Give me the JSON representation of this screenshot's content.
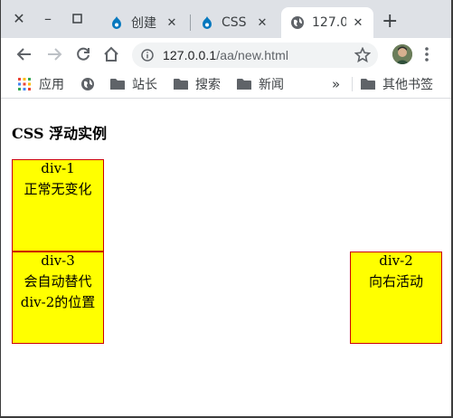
{
  "window_controls": {
    "close": "✕",
    "minimize": "–",
    "maximize": "□"
  },
  "tabs": [
    {
      "title": "创建",
      "icon": "drupal-icon",
      "close": "✕"
    },
    {
      "title": "CSS",
      "icon": "drupal-icon",
      "close": "✕"
    },
    {
      "title": "127.0",
      "icon": "globe-icon",
      "close": "✕",
      "active": true
    }
  ],
  "new_tab": "+",
  "toolbar": {
    "url_host": "127.0.0.1",
    "url_path": "/aa/new.html"
  },
  "bookmarks": {
    "items": [
      {
        "label": "应用",
        "icon": "apps-grid-icon"
      },
      {
        "label": "",
        "icon": "globe-icon"
      },
      {
        "label": "站长",
        "icon": "folder-icon"
      },
      {
        "label": "搜索",
        "icon": "folder-icon"
      },
      {
        "label": "新闻",
        "icon": "folder-icon"
      }
    ],
    "overflow": "»",
    "other": {
      "label": "其他书签",
      "icon": "folder-icon"
    }
  },
  "page": {
    "heading": "CSS 浮动实例",
    "boxes": [
      {
        "name": "div-1",
        "text": "正常无变化"
      },
      {
        "name": "div-2",
        "text": "向右活动"
      },
      {
        "name": "div-3",
        "text": "会自动替代",
        "text2": "div-2的位置"
      }
    ]
  },
  "colors": {
    "box_bg": "#ffff00",
    "box_border": "#cc0000",
    "tabstrip": "#dee1e6"
  }
}
